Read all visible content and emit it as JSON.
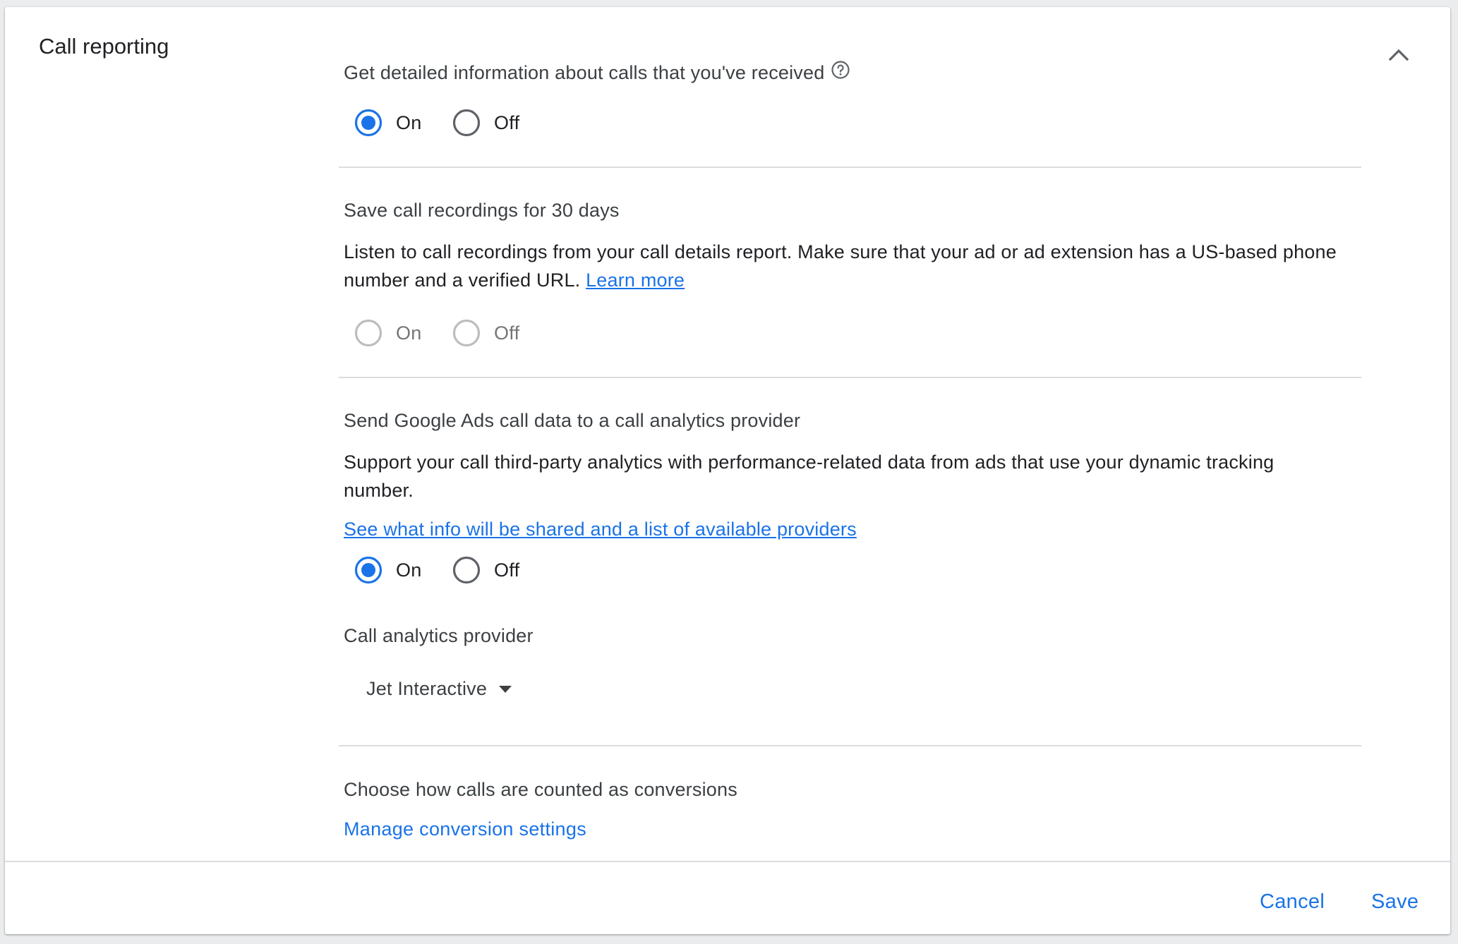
{
  "card": {
    "title": "Call reporting"
  },
  "colors": {
    "accent": "#1a73e8",
    "divider": "#dadce0",
    "disabled": "#bdbdbd"
  },
  "sections": {
    "detailed_info": {
      "title": "Get detailed information about calls that you've received",
      "help_icon": "help-circle-icon",
      "options": [
        "On",
        "Off"
      ],
      "selected": "On"
    },
    "recordings": {
      "title": "Save call recordings for 30 days",
      "description": "Listen to call recordings from your call details report. Make sure that your ad or ad extension has a US-based phone number and a verified URL.",
      "link": "Learn more",
      "options": [
        "On",
        "Off"
      ],
      "selected": null,
      "disabled": true
    },
    "analytics": {
      "title": "Send Google Ads call data to a call analytics provider",
      "description": "Support your call third-party analytics with performance-related data from ads that use your dynamic tracking number.",
      "link": "See what info will be shared and a list of available providers",
      "options": [
        "On",
        "Off"
      ],
      "selected": "On",
      "provider_label": "Call analytics provider",
      "provider_value": "Jet Interactive"
    },
    "conversions": {
      "title": "Choose how calls are counted as conversions",
      "link": "Manage conversion settings"
    }
  },
  "footer": {
    "cancel": "Cancel",
    "save": "Save"
  }
}
